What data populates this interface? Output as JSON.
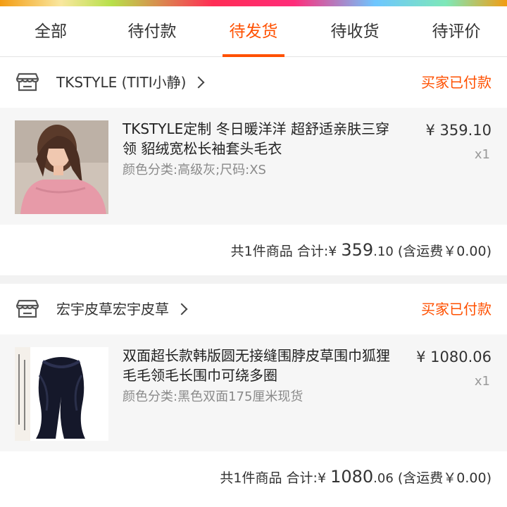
{
  "tabs": [
    {
      "label": "全部"
    },
    {
      "label": "待付款"
    },
    {
      "label": "待发货"
    },
    {
      "label": "待收货"
    },
    {
      "label": "待评价"
    }
  ],
  "active_tab": "待发货",
  "colors": {
    "accent": "#ff5000",
    "background": "#f2f2f2"
  },
  "orders": [
    {
      "shop_name": "TKSTYLE (TITI小静)",
      "status": "买家已付款",
      "item": {
        "title": "TKSTYLE定制 冬日暖洋洋 超舒适亲肤三穿领 貂绒宽松长袖套头毛衣",
        "sku": "颜色分类:高级灰;尺码:XS",
        "price": "¥ 359.10",
        "qty": "x1"
      },
      "summary": {
        "count_text": "共1件商品",
        "total_label": "合计:",
        "currency": "¥",
        "total_int": "359",
        "total_dec": ".10",
        "shipping": "(含运费￥0.00)"
      }
    },
    {
      "shop_name": "宏宇皮草宏宇皮草",
      "status": "买家已付款",
      "item": {
        "title": "双面超长款韩版圆无接缝围脖皮草围巾狐狸毛毛领毛长围巾可绕多圈",
        "sku": "颜色分类:黑色双面175厘米现货",
        "price": "¥ 1080.06",
        "qty": "x1"
      },
      "summary": {
        "count_text": "共1件商品",
        "total_label": "合计:",
        "currency": "¥",
        "total_int": "1080",
        "total_dec": ".06",
        "shipping": "(含运费￥0.00)"
      }
    }
  ]
}
